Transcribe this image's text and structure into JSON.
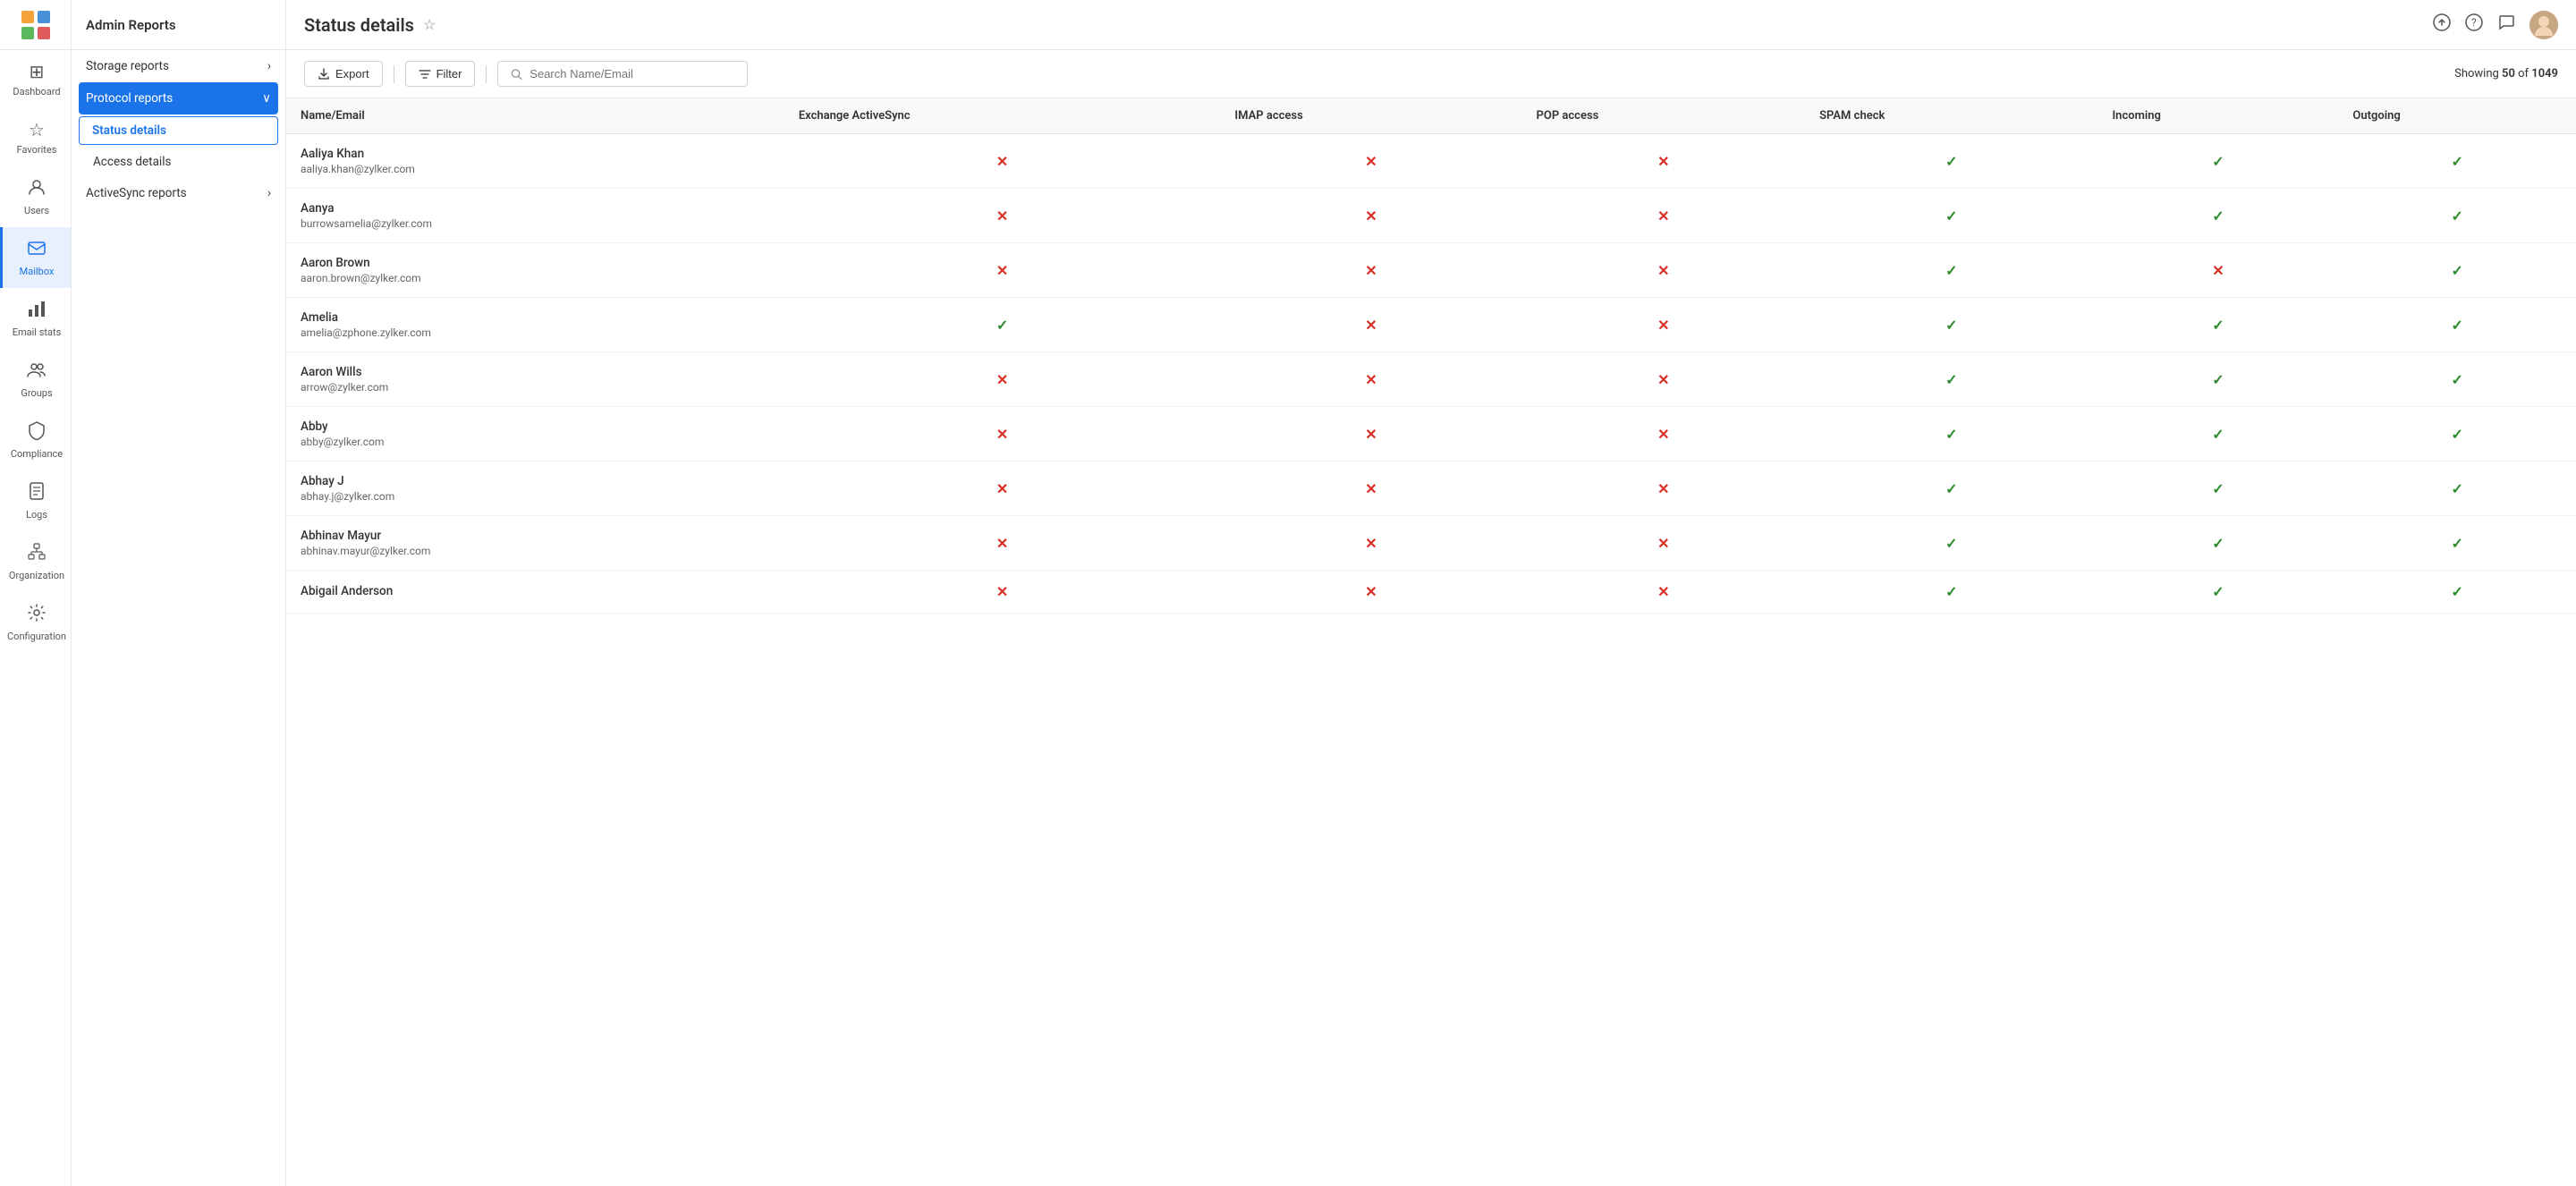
{
  "app": {
    "title": "Admin Reports"
  },
  "nav": {
    "items": [
      {
        "id": "dashboard",
        "label": "Dashboard",
        "icon": "⊞"
      },
      {
        "id": "favorites",
        "label": "Favorites",
        "icon": "★"
      },
      {
        "id": "users",
        "label": "Users",
        "icon": "👤"
      },
      {
        "id": "mailbox",
        "label": "Mailbox",
        "icon": "✉"
      },
      {
        "id": "email-stats",
        "label": "Email stats",
        "icon": "📊"
      },
      {
        "id": "groups",
        "label": "Groups",
        "icon": "👥"
      },
      {
        "id": "compliance",
        "label": "Compliance",
        "icon": "🛡"
      },
      {
        "id": "logs",
        "label": "Logs",
        "icon": "📋"
      },
      {
        "id": "organization",
        "label": "Organization",
        "icon": "🏢"
      },
      {
        "id": "configuration",
        "label": "Configuration",
        "icon": "⚙"
      }
    ],
    "active": "mailbox"
  },
  "sidebar": {
    "items": [
      {
        "id": "storage-reports",
        "label": "Storage reports",
        "hasArrow": true
      },
      {
        "id": "protocol-reports",
        "label": "Protocol reports",
        "hasArrow": true,
        "active": true,
        "sub": [
          {
            "id": "status-details",
            "label": "Status details",
            "active": true
          },
          {
            "id": "access-details",
            "label": "Access details"
          }
        ]
      },
      {
        "id": "activesync-reports",
        "label": "ActiveSync reports",
        "hasArrow": true
      }
    ]
  },
  "page": {
    "title": "Status details",
    "showing_label": "Showing",
    "showing_count": "50",
    "showing_total": "1049",
    "showing_text": "Showing 50 of 1049"
  },
  "toolbar": {
    "export_label": "Export",
    "filter_label": "Filter",
    "search_placeholder": "Search Name/Email"
  },
  "table": {
    "columns": [
      "Name/Email",
      "Exchange ActiveSync",
      "IMAP access",
      "POP access",
      "SPAM check",
      "Incoming",
      "Outgoing"
    ],
    "rows": [
      {
        "name": "Aaliya Khan",
        "email": "aaliya.khan@zylker.com",
        "eas": false,
        "imap": false,
        "pop": false,
        "spam": true,
        "incoming": true,
        "outgoing": true
      },
      {
        "name": "Aanya",
        "email": "burrowsamelia@zylker.com",
        "eas": false,
        "imap": false,
        "pop": false,
        "spam": true,
        "incoming": true,
        "outgoing": true
      },
      {
        "name": "Aaron Brown",
        "email": "aaron.brown@zylker.com",
        "eas": false,
        "imap": false,
        "pop": false,
        "spam": true,
        "incoming": false,
        "outgoing": true
      },
      {
        "name": "Amelia",
        "email": "amelia@zphone.zylker.com",
        "eas": true,
        "imap": false,
        "pop": false,
        "spam": true,
        "incoming": true,
        "outgoing": true
      },
      {
        "name": "Aaron Wills",
        "email": "arrow@zylker.com",
        "eas": false,
        "imap": false,
        "pop": false,
        "spam": true,
        "incoming": true,
        "outgoing": true
      },
      {
        "name": "Abby",
        "email": "abby@zylker.com",
        "eas": false,
        "imap": false,
        "pop": false,
        "spam": true,
        "incoming": true,
        "outgoing": true
      },
      {
        "name": "Abhay J",
        "email": "abhay.j@zylker.com",
        "eas": false,
        "imap": false,
        "pop": false,
        "spam": true,
        "incoming": true,
        "outgoing": true
      },
      {
        "name": "Abhinav Mayur",
        "email": "abhinav.mayur@zylker.com",
        "eas": false,
        "imap": false,
        "pop": false,
        "spam": true,
        "incoming": true,
        "outgoing": true
      },
      {
        "name": "Abigail Anderson",
        "email": "",
        "eas": false,
        "imap": false,
        "pop": false,
        "spam": true,
        "incoming": true,
        "outgoing": true
      }
    ]
  },
  "icons": {
    "check": "✓",
    "cross": "✕",
    "arrow_right": "›",
    "arrow_down": "∨",
    "star": "☆",
    "upload": "⬆",
    "question": "?",
    "chat": "💬"
  }
}
